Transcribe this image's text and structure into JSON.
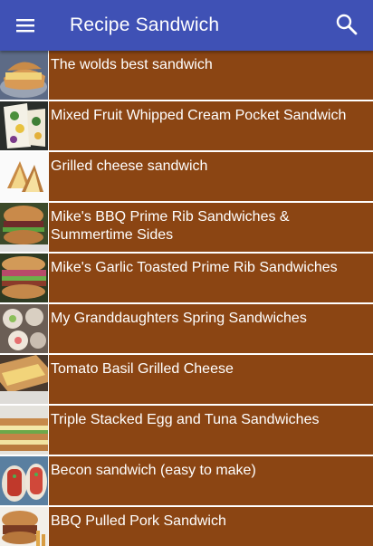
{
  "app": {
    "title": "Recipe Sandwich",
    "colors": {
      "appbar": "#3f51b5",
      "row_background": "#8b4513",
      "text": "#ffffff"
    },
    "icons": {
      "menu": "menu-icon",
      "search": "search-icon"
    }
  },
  "recipes": [
    {
      "title": "The wolds best sandwich"
    },
    {
      "title": "Mixed Fruit Whipped Cream Pocket Sandwich"
    },
    {
      "title": "Grilled cheese sandwich"
    },
    {
      "title": "Mike's BBQ Prime Rib Sandwiches & Summertime Sides"
    },
    {
      "title": "Mike's Garlic Toasted Prime Rib Sandwiches"
    },
    {
      "title": "My Granddaughters Spring Sandwiches"
    },
    {
      "title": "Tomato Basil Grilled Cheese"
    },
    {
      "title": "Triple Stacked Egg and Tuna Sandwiches"
    },
    {
      "title": "Becon sandwich (easy to make)"
    },
    {
      "title": "BBQ Pulled Pork Sandwich"
    }
  ]
}
